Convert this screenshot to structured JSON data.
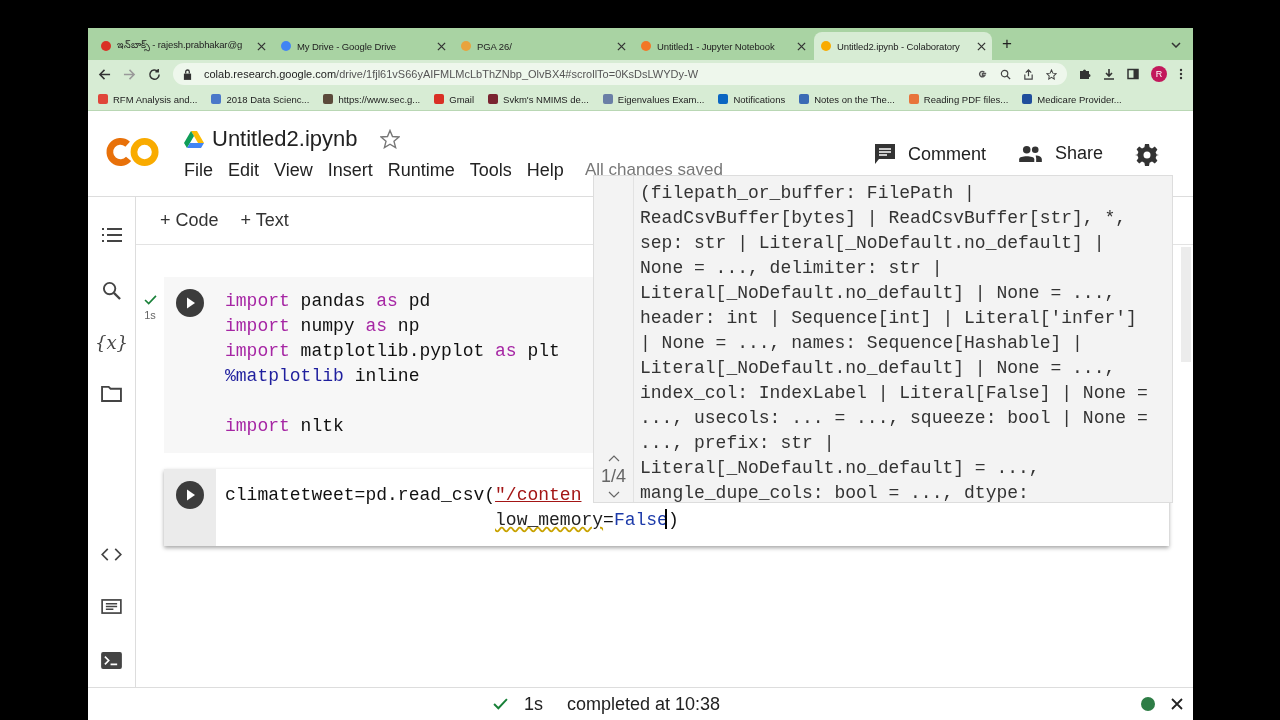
{
  "browser": {
    "tabs": [
      {
        "title": "ఇన్‌బాక్స్ - rajesh.prabhakar@g",
        "selected": false
      },
      {
        "title": "My Drive - Google Drive",
        "selected": false
      },
      {
        "title": "PGA 26/",
        "selected": false
      },
      {
        "title": "Untitled1 - Jupyter Notebook",
        "selected": false
      },
      {
        "title": "Untitled2.ipynb - Colaboratory",
        "selected": true
      }
    ],
    "new_tab": "+",
    "url_host": "colab.research.google.com",
    "url_path": "/drive/1fjl61vS66yAIFMLMcLbThZNbp_OlvBX4#scrollTo=0KsDsLWYDy-W",
    "profile": "R",
    "bookmarks": [
      "RFM Analysis and...",
      "2018 Data Scienc...",
      "https://www.sec.g...",
      "Gmail",
      "Svkm's NMIMS de...",
      "Eigenvalues Exam...",
      "Notifications",
      "Notes on the The...",
      "Reading PDF files...",
      "Medicare Provider..."
    ]
  },
  "header": {
    "title": "Untitled2.ipynb",
    "menu": [
      "File",
      "Edit",
      "View",
      "Insert",
      "Runtime",
      "Tools",
      "Help"
    ],
    "save_status": "All changes saved",
    "comment": "Comment",
    "share": "Share"
  },
  "toolbar": [
    "+ Code",
    "+ Text"
  ],
  "sidebar": {
    "variables_label": "{x}"
  },
  "cells": [
    {
      "focused": false,
      "status": "1s",
      "executed": true,
      "lines": [
        {
          "kind": "code",
          "tokens": [
            {
              "kind": "keyword",
              "text": "import"
            },
            {
              "kind": "plain",
              "text": " pandas "
            },
            {
              "kind": "keyword",
              "text": "as"
            },
            {
              "kind": "plain",
              "text": " pd"
            }
          ]
        },
        {
          "kind": "code",
          "tokens": [
            {
              "kind": "keyword",
              "text": "import"
            },
            {
              "kind": "plain",
              "text": " numpy "
            },
            {
              "kind": "keyword",
              "text": "as"
            },
            {
              "kind": "plain",
              "text": " np"
            }
          ]
        },
        {
          "kind": "code",
          "tokens": [
            {
              "kind": "keyword",
              "text": "import"
            },
            {
              "kind": "plain",
              "text": " matplotlib.pyplot "
            },
            {
              "kind": "keyword",
              "text": "as"
            },
            {
              "kind": "plain",
              "text": " plt"
            }
          ]
        },
        {
          "kind": "code",
          "tokens": [
            {
              "kind": "magic",
              "text": "%matplotlib"
            },
            {
              "kind": "plain",
              "text": " inline"
            }
          ]
        },
        {
          "kind": "blank"
        },
        {
          "kind": "code",
          "tokens": [
            {
              "kind": "keyword",
              "text": "import"
            },
            {
              "kind": "plain",
              "text": " nltk"
            }
          ]
        }
      ]
    },
    {
      "focused": true,
      "lines": [
        {
          "kind": "code",
          "tokens": [
            {
              "kind": "plain",
              "text": "climatetweet=pd.read_csv("
            },
            {
              "kind": "string",
              "text": "\"/conten"
            }
          ]
        },
        {
          "kind": "continuation",
          "tokens": [
            {
              "kind": "warn",
              "text": "low_memory"
            },
            {
              "kind": "plain",
              "text": "="
            },
            {
              "kind": "constant",
              "text": "False",
              "cursor_after": true
            },
            {
              "kind": "plain",
              "text": ")"
            }
          ]
        }
      ]
    }
  ],
  "signature_help": {
    "counter": "1/4",
    "lines": [
      "(filepath_or_buffer: FilePath |",
      "ReadCsvBuffer[bytes] | ReadCsvBuffer[str], *,",
      "sep: str | Literal[_NoDefault.no_default] |",
      "None = ..., delimiter: str |",
      "Literal[_NoDefault.no_default] | None = ...,",
      "header: int | Sequence[int] | Literal['infer']",
      "| None = ..., names: Sequence[Hashable] |",
      "Literal[_NoDefault.no_default] | None = ...,",
      "index_col: IndexLabel | Literal[False] | None =",
      "..., usecols: ... = ..., squeeze: bool | None =",
      "..., prefix: str |",
      "Literal[_NoDefault.no_default] = ...,",
      "mangle_dupe_cols: bool = ..., dtype:"
    ]
  },
  "status_bar": {
    "duration": "1s",
    "message": "completed at 10:38",
    "connected": true
  }
}
